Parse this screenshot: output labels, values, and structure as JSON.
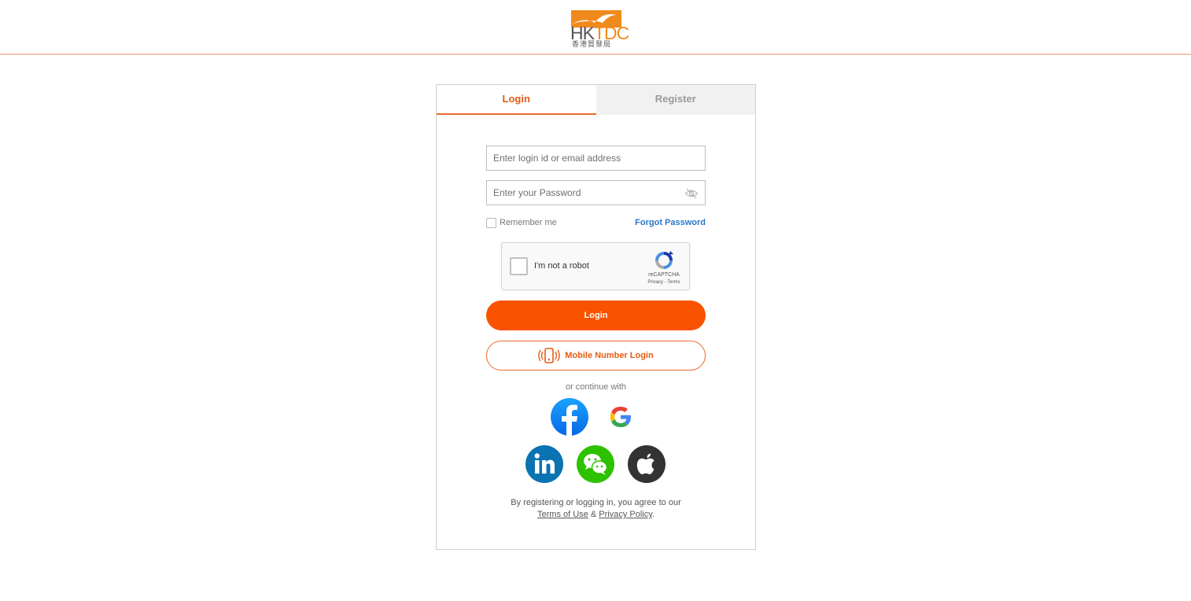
{
  "header": {
    "logo": {
      "wordmark_left": "HK",
      "wordmark_right": "TDC",
      "chinese_name": "香港貿發局",
      "brand_color": "#f08a1c"
    },
    "divider_color": "#f2c3b2"
  },
  "tabs": [
    {
      "label": "Login",
      "active": true
    },
    {
      "label": "Register",
      "active": false
    }
  ],
  "form": {
    "login_field": {
      "placeholder": "Enter login id or email address",
      "value": ""
    },
    "password_field": {
      "placeholder": "Enter your Password",
      "value": "",
      "toggle_icon": "eye-off-icon"
    },
    "remember_me": {
      "label": "Remember me",
      "checked": false
    },
    "forgot_password": "Forgot Password",
    "recaptcha": {
      "label": "I'm not a robot",
      "brand": "reCAPTCHA",
      "links": "Privacy - Terms",
      "checked": false
    },
    "login_button": "Login",
    "mobile_login_button": "Mobile Number Login",
    "continue_with": "or continue with"
  },
  "social_logins": [
    {
      "name": "Facebook",
      "icon": "facebook-icon",
      "color": "#1877f2"
    },
    {
      "name": "Google",
      "icon": "google-icon",
      "color": "#4285f4"
    },
    {
      "name": "LinkedIn",
      "icon": "linkedin-icon",
      "color": "#0a73b1"
    },
    {
      "name": "WeChat",
      "icon": "wechat-icon",
      "color": "#2dc100"
    },
    {
      "name": "Apple",
      "icon": "apple-icon",
      "color": "#333333"
    }
  ],
  "footer": {
    "agreement_text": "By registering or logging in, you agree to our",
    "terms_link": "Terms of Use",
    "ampersand": "&",
    "privacy_link": "Privacy Policy",
    "period": "."
  },
  "colors": {
    "accent": "#fa5300",
    "link": "#2a76c9"
  }
}
